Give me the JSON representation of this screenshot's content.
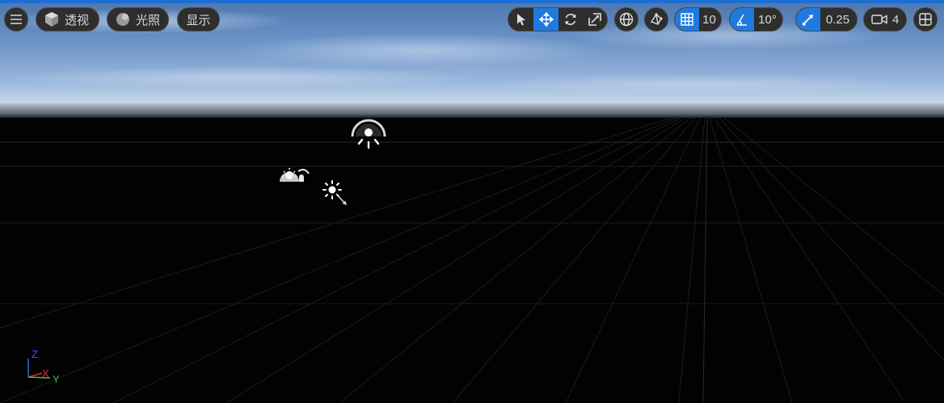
{
  "toolbar": {
    "menu_icon": "hamburger-menu-icon",
    "perspective_label": "透视",
    "lighting_label": "光照",
    "show_label": "显示",
    "grid_snap_value": "10",
    "rotation_snap_value": "10°",
    "scale_snap_value": "0.25",
    "camera_speed_value": "4"
  },
  "axis_indicator": {
    "z": "Z",
    "x": "X",
    "y": "Y"
  },
  "colors": {
    "active_blue": "#1f7ae0",
    "toolbar_bg": "#2e2e2e",
    "axis_x": "#e03030",
    "axis_y": "#40c040",
    "axis_z": "#3060e0"
  }
}
